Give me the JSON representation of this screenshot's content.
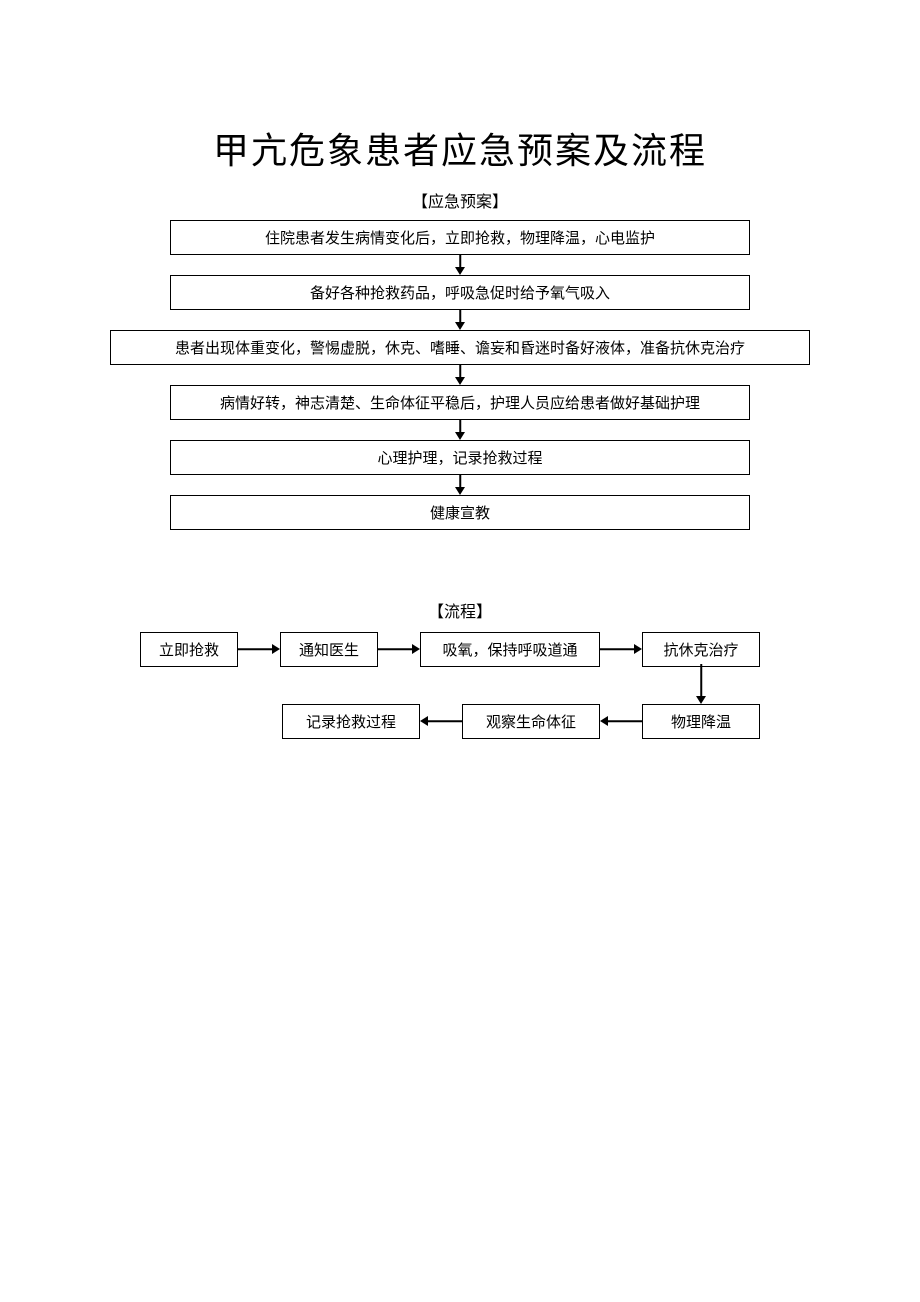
{
  "title": "甲亢危象患者应急预案及流程",
  "section1_label": "【应急预案】",
  "plan_steps": [
    "住院患者发生病情变化后，立即抢救，物理降温，心电监护",
    "备好各种抢救药品，呼吸急促时给予氧气吸入",
    "患者出现体重变化，警惕虚脱，休克、嗜睡、谵妄和昏迷时备好液体，准备抗休克治疗",
    "病情好转，神志清楚、生命体征平稳后，护理人员应给患者做好基础护理",
    "心理护理，记录抢救过程",
    "健康宣教"
  ],
  "section2_label": "【流程】",
  "flow_steps": {
    "b1": "立即抢救",
    "b2": "通知医生",
    "b3": "吸氧，保持呼吸道通",
    "b4": "抗休克治疗",
    "b5": "物理降温",
    "b6": "观察生命体征",
    "b7": "记录抢救过程"
  }
}
